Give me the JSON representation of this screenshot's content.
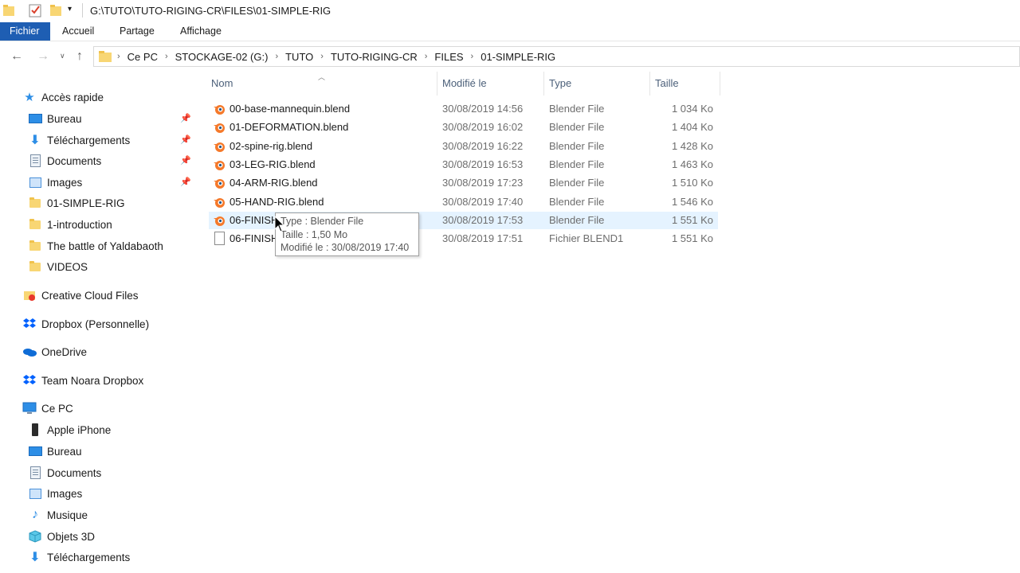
{
  "window": {
    "title": "G:\\TUTO\\TUTO-RIGING-CR\\FILES\\01-SIMPLE-RIG",
    "accent": "#1e5eb3"
  },
  "ribbon": {
    "tabs": [
      {
        "label": "Fichier",
        "active": true
      },
      {
        "label": "Accueil"
      },
      {
        "label": "Partage"
      },
      {
        "label": "Affichage"
      }
    ]
  },
  "address": {
    "crumbs": [
      "Ce PC",
      "STOCKAGE-02 (G:)",
      "TUTO",
      "TUTO-RIGING-CR",
      "FILES",
      "01-SIMPLE-RIG"
    ]
  },
  "sidebar": {
    "quick_access": "Accès rapide",
    "pinned": [
      {
        "label": "Bureau",
        "icon": "desktop-icon"
      },
      {
        "label": "Téléchargements",
        "icon": "download-icon"
      },
      {
        "label": "Documents",
        "icon": "documents-icon"
      },
      {
        "label": "Images",
        "icon": "images-icon"
      }
    ],
    "folders": [
      "01-SIMPLE-RIG",
      "1-introduction",
      "The battle of Yaldabaoth",
      "VIDEOS"
    ],
    "creative_cloud": "Creative Cloud Files",
    "dropbox": "Dropbox (Personnelle)",
    "onedrive": "OneDrive",
    "team_dropbox": "Team Noara Dropbox",
    "this_pc": "Ce PC",
    "pc_items": [
      {
        "label": "Apple iPhone",
        "icon": "phone-icon"
      },
      {
        "label": "Bureau",
        "icon": "desktop-icon"
      },
      {
        "label": "Documents",
        "icon": "documents-icon"
      },
      {
        "label": "Images",
        "icon": "images-icon"
      },
      {
        "label": "Musique",
        "icon": "music-icon"
      },
      {
        "label": "Objets 3D",
        "icon": "3d-objects-icon"
      },
      {
        "label": "Téléchargements",
        "icon": "download-icon"
      }
    ]
  },
  "columns": {
    "name": "Nom",
    "modified": "Modifié le",
    "type": "Type",
    "size": "Taille"
  },
  "files": [
    {
      "name": "00-base-mannequin.blend",
      "date": "30/08/2019 14:56",
      "type": "Blender File",
      "size": "1 034 Ko",
      "icon": "blender-icon"
    },
    {
      "name": "01-DEFORMATION.blend",
      "date": "30/08/2019 16:02",
      "type": "Blender File",
      "size": "1 404 Ko",
      "icon": "blender-icon"
    },
    {
      "name": "02-spine-rig.blend",
      "date": "30/08/2019 16:22",
      "type": "Blender File",
      "size": "1 428 Ko",
      "icon": "blender-icon"
    },
    {
      "name": "03-LEG-RIG.blend",
      "date": "30/08/2019 16:53",
      "type": "Blender File",
      "size": "1 463 Ko",
      "icon": "blender-icon"
    },
    {
      "name": "04-ARM-RIG.blend",
      "date": "30/08/2019 17:23",
      "type": "Blender File",
      "size": "1 510 Ko",
      "icon": "blender-icon"
    },
    {
      "name": "05-HAND-RIG.blend",
      "date": "30/08/2019 17:40",
      "type": "Blender File",
      "size": "1 546 Ko",
      "icon": "blender-icon"
    },
    {
      "name": "06-FINISH",
      "date": "30/08/2019 17:53",
      "type": "Blender File",
      "size": "1 551 Ko",
      "icon": "blender-icon",
      "hover": true
    },
    {
      "name": "06-FINISH",
      "date": "30/08/2019 17:51",
      "type": "Fichier BLEND1",
      "size": "1 551 Ko",
      "icon": "generic-file-icon"
    }
  ],
  "tooltip": {
    "type_line": "Type : Blender File",
    "size_line": "Taille : 1,50 Mo",
    "modified_line": "Modifié le : 30/08/2019 17:40"
  }
}
